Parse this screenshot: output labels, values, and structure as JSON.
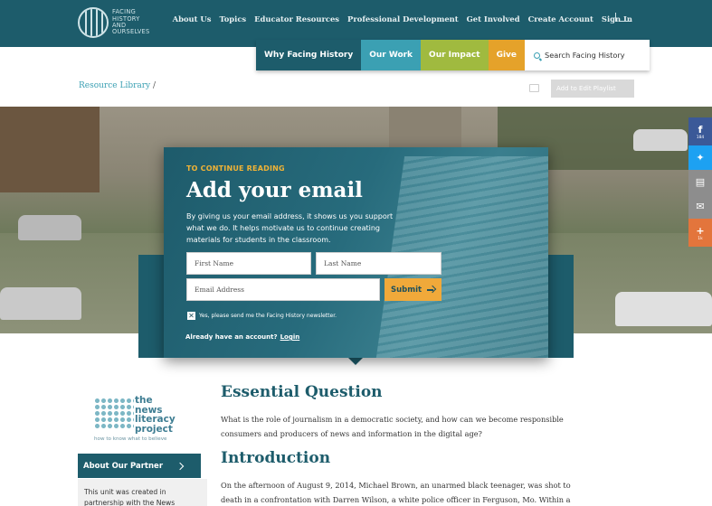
{
  "logo": {
    "text_lines": [
      "FACING",
      "HISTORY",
      "AND",
      "OURSELVES"
    ]
  },
  "nav": {
    "items": [
      "About Us",
      "Topics",
      "Educator Resources",
      "Professional Development",
      "Get Involved",
      "Create Account",
      "Sign In"
    ]
  },
  "subnav": {
    "tabs": [
      "Why Facing History",
      "Our Work",
      "Our Impact",
      "Give"
    ],
    "search_placeholder": "Search Facing History"
  },
  "breadcrumb": {
    "link": "Resource Library",
    "separator": "/"
  },
  "playlist_button": "Add to Edit Playlist",
  "modal": {
    "kicker": "TO CONTINUE READING",
    "title": "Add your email",
    "description": "By giving us your email address, it shows us you support what we do. It helps motivate us to continue creating materials for students in the classroom.",
    "first_name_placeholder": "First Name",
    "last_name_placeholder": "Last Name",
    "email_placeholder": "Email Address",
    "submit_label": "Submit",
    "newsletter_label": "Yes, please send me the Facing History newsletter.",
    "newsletter_checked": true,
    "account_prompt": "Already have an account?",
    "login_label": "Login"
  },
  "share": {
    "facebook_count": "184",
    "plus_count": "1k"
  },
  "partner": {
    "logo_lines": [
      "the",
      "news",
      "literacy",
      "project"
    ],
    "tagline": "how to know what to believe",
    "button_label": "About Our Partner",
    "text": "This unit was created in partnership with the News"
  },
  "content": {
    "essential_heading": "Essential Question",
    "essential_text": "What is the role of journalism in a democratic society, and how can we become responsible consumers and producers of news and information in the digital age?",
    "intro_heading": "Introduction",
    "intro_text": "On the afternoon of August 9, 2014, Michael Brown, an unarmed black teenager, was shot to death in a confrontation with Darren Wilson, a white police officer in Ferguson, Mo. Within a"
  },
  "colors": {
    "brand_teal": "#1d5c6b",
    "accent_blue": "#3ba0b3",
    "accent_green": "#a0ba3f",
    "accent_orange": "#e5a22a"
  }
}
